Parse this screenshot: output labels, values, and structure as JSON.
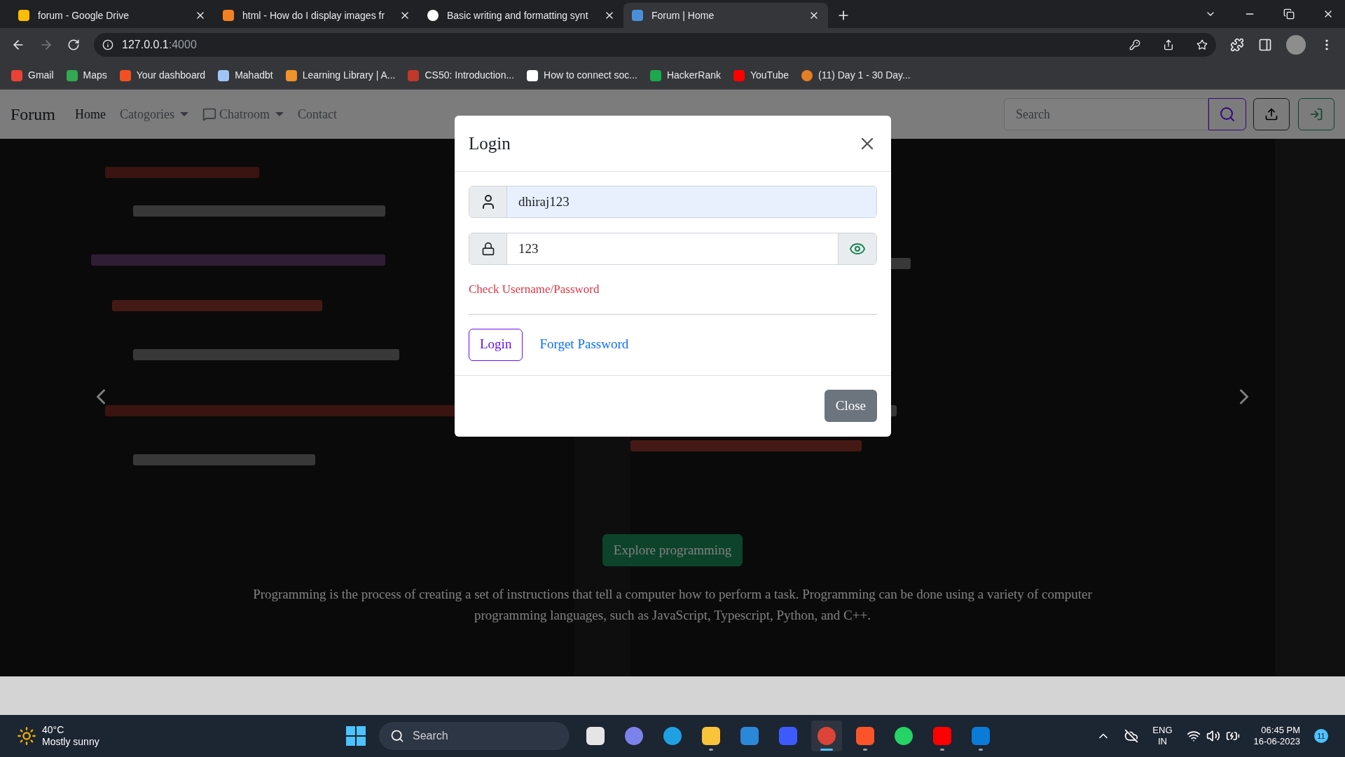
{
  "browser": {
    "tabs": [
      {
        "title": "forum - Google Drive",
        "kind": "drive",
        "selected": false
      },
      {
        "title": "html - How do I display images fr",
        "kind": "stack",
        "selected": false
      },
      {
        "title": "Basic writing and formatting synt",
        "kind": "github",
        "selected": false
      },
      {
        "title": "Forum | Home",
        "kind": "page",
        "selected": true
      }
    ],
    "address": {
      "host": "127.0.0.1",
      "port": ":4000"
    },
    "bookmarks": [
      {
        "label": "Gmail",
        "kind": "mail"
      },
      {
        "label": "Maps",
        "kind": "maps"
      },
      {
        "label": "Your dashboard",
        "kind": "grid"
      },
      {
        "label": "Mahadbt",
        "kind": "doc"
      },
      {
        "label": "Learning Library | A...",
        "kind": "cube"
      },
      {
        "label": "CS50: Introduction...",
        "kind": "shield"
      },
      {
        "label": "How to connect soc...",
        "kind": "letter"
      },
      {
        "label": "HackerRank",
        "kind": "hr"
      },
      {
        "label": "YouTube",
        "kind": "play"
      },
      {
        "label": "(11) Day 1 - 30 Day...",
        "kind": "flame"
      }
    ]
  },
  "navbar": {
    "brand": "Forum",
    "links": [
      {
        "label": "Home",
        "kind": "link",
        "selected": true
      },
      {
        "label": "Catogories",
        "kind": "dropdown",
        "selected": false
      },
      {
        "label": "Chatroom",
        "kind": "chat-dropdown",
        "selected": false
      },
      {
        "label": "Contact",
        "kind": "link",
        "selected": false
      }
    ],
    "search": {
      "placeholder": "Search"
    }
  },
  "carousel": {
    "button": "Explore programming",
    "caption": "Programming is the process of creating a set of instructions that tell a computer how to perform a task. Programming can be done using a variety of computer programming languages, such as JavaScript, Typescript, Python, and C++."
  },
  "modal": {
    "title": "Login",
    "username": "dhiraj123",
    "password": "123",
    "error": "Check Username/Password",
    "login_button": "Login",
    "forgot_link": "Forget Password",
    "close_button": "Close"
  },
  "taskbar": {
    "weather": {
      "temperature": "40°C",
      "condition": "Mostly sunny"
    },
    "search": {
      "placeholder": "Search"
    },
    "apps": [
      {
        "kind": "taskview",
        "running": false,
        "selected": false
      },
      {
        "kind": "meet",
        "running": false,
        "selected": false
      },
      {
        "kind": "edge",
        "running": false,
        "selected": false
      },
      {
        "kind": "files",
        "running": true,
        "selected": false
      },
      {
        "kind": "mail",
        "running": false,
        "selected": false
      },
      {
        "kind": "blue",
        "running": false,
        "selected": false
      },
      {
        "kind": "chrome",
        "running": true,
        "selected": true
      },
      {
        "kind": "brave",
        "running": true,
        "selected": false
      },
      {
        "kind": "whatsapp",
        "running": false,
        "selected": false
      },
      {
        "kind": "youtube",
        "running": true,
        "selected": false
      },
      {
        "kind": "vscode",
        "running": true,
        "selected": false
      }
    ],
    "language": [
      "ENG",
      "IN"
    ],
    "time": "06:45 PM",
    "date": "16-06-2023",
    "notifications": "11"
  }
}
